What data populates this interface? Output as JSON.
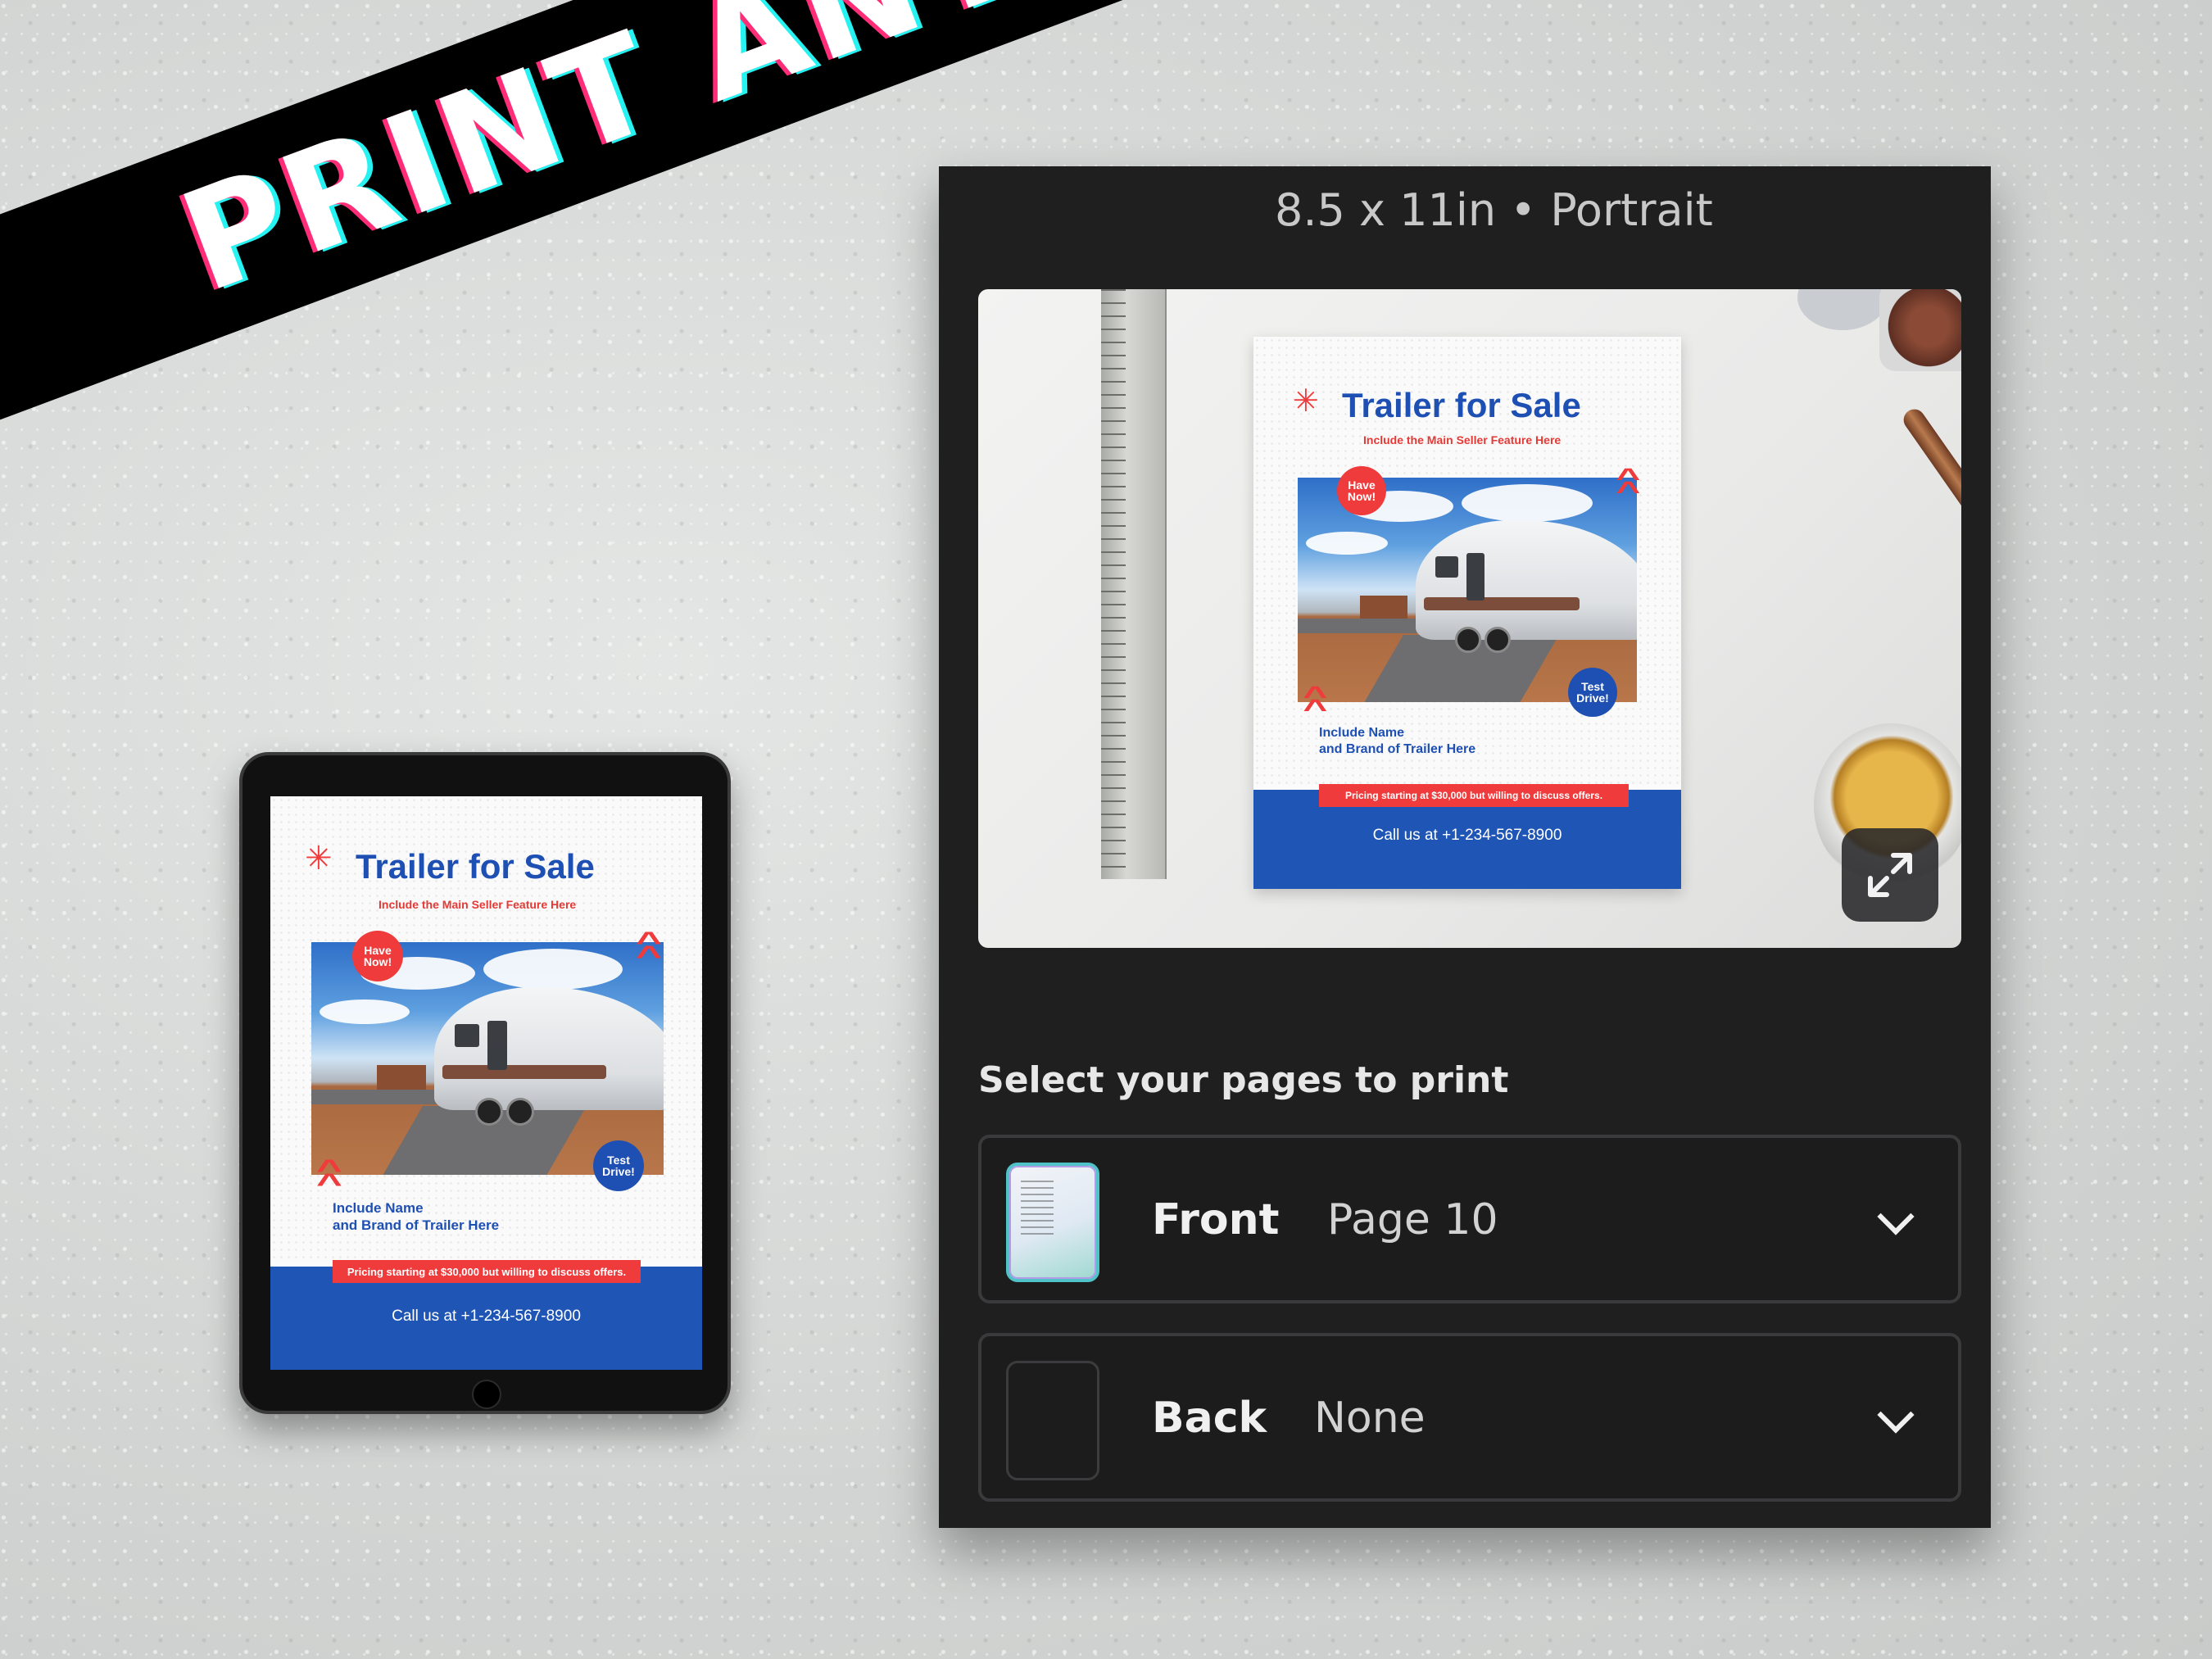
{
  "banner": {
    "text": "PRINT ANYWHERE"
  },
  "flyer": {
    "title": "Trailer for Sale",
    "subtitle": "Include the Main Seller Feature Here",
    "badge_top": "Have Now!",
    "badge_bottom": "Test Drive!",
    "name_line1": "Include Name",
    "name_line2": "and Brand of Trailer Here",
    "pricing": "Pricing starting at $30,000 but willing to discuss offers.",
    "call": "Call us at +1-234-567-8900"
  },
  "print_panel": {
    "size_label": "8.5 x 11in • Portrait",
    "section_title": "Select your pages to print",
    "pages": [
      {
        "name": "Front",
        "value": "Page 10"
      },
      {
        "name": "Back",
        "value": "None"
      }
    ]
  },
  "icons": {
    "expand": "expand-icon",
    "chevron": "chevron-down-icon",
    "star": "asterisk-icon"
  },
  "colors": {
    "brand_blue": "#1e4fb3",
    "accent_red": "#ef3b3b",
    "panel_bg": "#1f1f20"
  }
}
